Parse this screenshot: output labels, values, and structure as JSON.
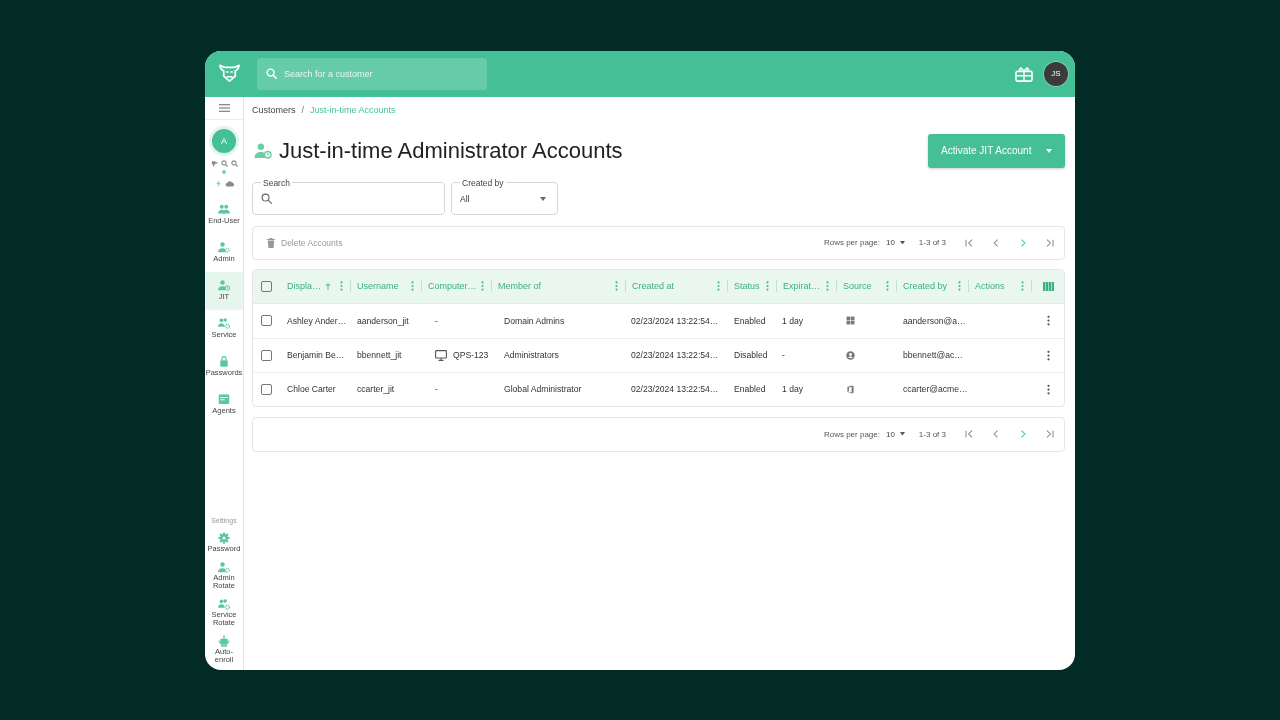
{
  "topbar": {
    "search": {
      "placeholder": "Search for a customer"
    },
    "user_avatar": "JS"
  },
  "sidebar": {
    "customer_avatar": "A",
    "items": [
      {
        "label": "End-User",
        "selected": false
      },
      {
        "label": "Admin",
        "selected": false
      },
      {
        "label": "JIT",
        "selected": true
      },
      {
        "label": "Service",
        "selected": false
      },
      {
        "label": "Passwords",
        "selected": false
      },
      {
        "label": "Agents",
        "selected": false
      }
    ],
    "settings": {
      "heading": "Settings",
      "items": [
        {
          "label": "Password",
          "selected": false
        },
        {
          "label": "Admin Rotate",
          "selected": false
        },
        {
          "label": "Service Rotate",
          "selected": false
        },
        {
          "label": "Auto-enroll",
          "selected": false
        }
      ]
    }
  },
  "breadcrumb": {
    "separator": "/",
    "items": [
      {
        "label": "Customers",
        "current": false
      },
      {
        "label": "Just-in-time Accounts",
        "current": true
      }
    ]
  },
  "title": "Just-in-time Administrator Accounts",
  "activate_button": {
    "label": "Activate JIT Account"
  },
  "filters": {
    "search": {
      "label": "Search"
    },
    "created_by": {
      "label": "Created by",
      "value": "All"
    }
  },
  "toolbar": {
    "delete_button": {
      "label": "Delete Accounts",
      "disabled": true
    },
    "pagination": {
      "rows_per_page_label": "Rows per page:",
      "rows_per_page": "10",
      "range": "1-3 of 3",
      "buttons": [
        {
          "kind": "first",
          "disabled": true
        },
        {
          "kind": "previous",
          "disabled": true
        },
        {
          "kind": "next",
          "disabled": false
        },
        {
          "kind": "last",
          "disabled": true
        }
      ]
    }
  },
  "table": {
    "select_all": {
      "checked": false
    },
    "columns": [
      {
        "label": "Displa…",
        "sorted": true
      },
      {
        "label": "Username",
        "sorted": false
      },
      {
        "label": "Computer…",
        "sorted": false
      },
      {
        "label": "Member of",
        "sorted": false
      },
      {
        "label": "Created at",
        "sorted": false
      },
      {
        "label": "Status",
        "sorted": false
      },
      {
        "label": "Expirat…",
        "sorted": false
      },
      {
        "label": "Source",
        "sorted": false
      },
      {
        "label": "Created by",
        "sorted": false
      },
      {
        "label": "Actions",
        "sorted": false
      }
    ],
    "rows": [
      {
        "checked": false,
        "display_name": "Ashley Ander…",
        "username": "aanderson_jit",
        "computer": {
          "text": "-",
          "device": false
        },
        "member_of": "Domain Admins",
        "created_at": "02/23/2024 13:22:54…",
        "status": "Enabled",
        "expiration": "1 day",
        "source": {
          "kind": "windows"
        },
        "created_by": "aanderson@a…"
      },
      {
        "checked": false,
        "display_name": "Benjamin Be…",
        "username": "bbennett_jit",
        "computer": {
          "text": "QPS-123",
          "device": true
        },
        "member_of": "Administrators",
        "created_at": "02/23/2024 13:22:54…",
        "status": "Disabled",
        "expiration": "-",
        "source": {
          "kind": "directory"
        },
        "created_by": "bbennett@ac…"
      },
      {
        "checked": false,
        "display_name": "Chloe Carter",
        "username": "ccarter_jit",
        "computer": {
          "text": "-",
          "device": false
        },
        "member_of": "Global Administrator",
        "created_at": "02/23/2024 13:22:54…",
        "status": "Enabled",
        "expiration": "1 day",
        "source": {
          "kind": "office"
        },
        "created_by": "ccarter@acme…"
      }
    ]
  },
  "footer": {
    "pagination": {
      "rows_per_page_label": "Rows per page:",
      "rows_per_page": "10",
      "range": "1-3 of 3",
      "buttons": [
        {
          "kind": "first",
          "disabled": true
        },
        {
          "kind": "previous",
          "disabled": true
        },
        {
          "kind": "next",
          "disabled": false
        },
        {
          "kind": "last",
          "disabled": true
        }
      ]
    }
  }
}
